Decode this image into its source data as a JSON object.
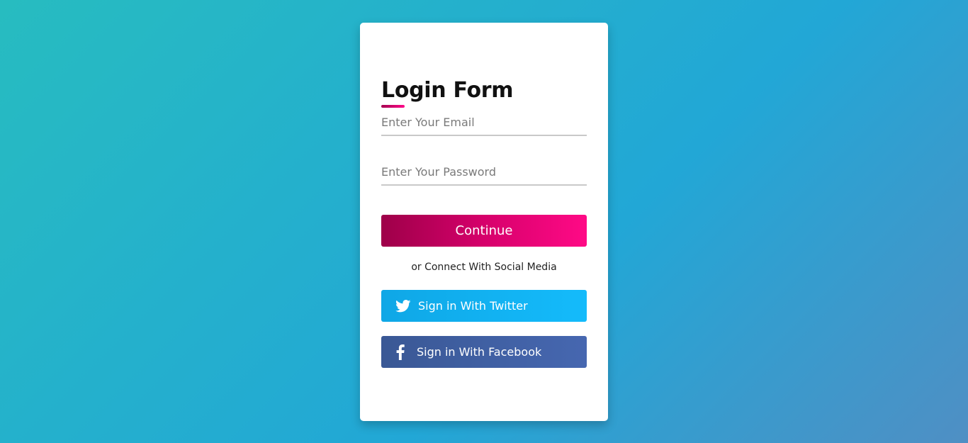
{
  "login": {
    "title": "Login Form",
    "email_placeholder": "Enter Your Email",
    "password_placeholder": "Enter Your Password",
    "continue_label": "Continue",
    "social_text": "or Connect With Social Media",
    "twitter_label": "Sign in With Twitter",
    "facebook_label": "Sign in With Facebook"
  },
  "icons": {
    "twitter": "twitter-icon",
    "facebook": "facebook-icon"
  },
  "colors": {
    "background_start": "#27bcc0",
    "background_end": "#4f8fc4",
    "continue_start": "#9e0049",
    "continue_end": "#ff0a86",
    "twitter": "#14bbfb",
    "facebook": "#4667b0"
  }
}
